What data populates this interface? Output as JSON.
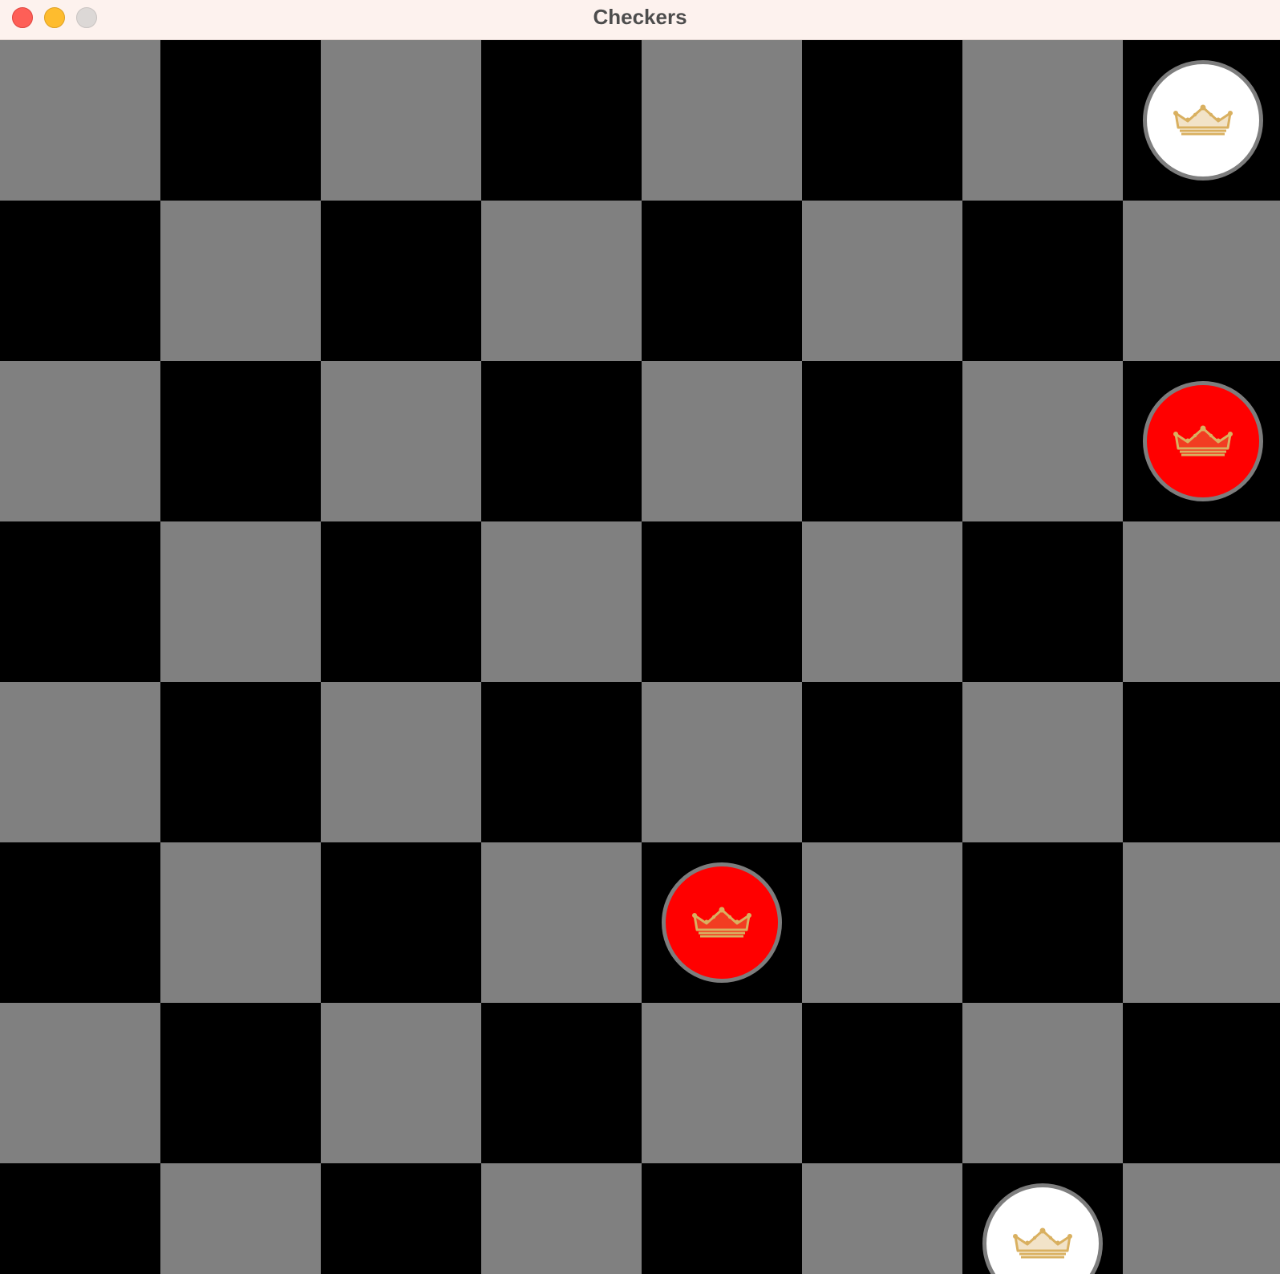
{
  "window": {
    "title": "Checkers",
    "buttons": [
      "close",
      "minimize",
      "zoom"
    ]
  },
  "board": {
    "rows": 8,
    "cols": 8,
    "colors": {
      "light": "#808080",
      "dark": "#000000"
    },
    "first_square": "light"
  },
  "pieces": [
    {
      "row": 0,
      "col": 7,
      "color": "white",
      "fill": "#ffffff",
      "king": true
    },
    {
      "row": 2,
      "col": 7,
      "color": "red",
      "fill": "#ff0000",
      "king": true
    },
    {
      "row": 5,
      "col": 4,
      "color": "red",
      "fill": "#ff0000",
      "king": true
    },
    {
      "row": 7,
      "col": 6,
      "color": "white",
      "fill": "#ffffff",
      "king": true
    }
  ],
  "crown": {
    "icon": "crown-icon",
    "color": "#d9b060"
  }
}
